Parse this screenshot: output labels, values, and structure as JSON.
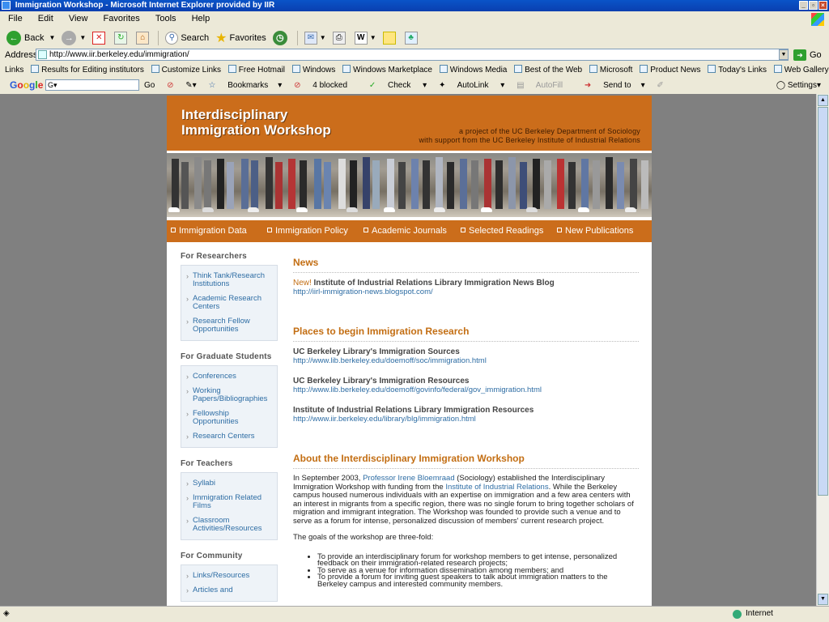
{
  "window": {
    "title": "Immigration Workshop - Microsoft Internet Explorer provided by IIR"
  },
  "menu": [
    "File",
    "Edit",
    "View",
    "Favorites",
    "Tools",
    "Help"
  ],
  "toolbar": {
    "back": "Back",
    "search": "Search",
    "favorites": "Favorites"
  },
  "address": {
    "label": "Address",
    "url": "http://www.iir.berkeley.edu/immigration/",
    "go": "Go"
  },
  "links_bar": {
    "label": "Links",
    "items": [
      "Results for Editing institutors",
      "Customize Links",
      "Free Hotmail",
      "Windows",
      "Windows Marketplace",
      "Windows Media",
      "Best of the Web",
      "Microsoft",
      "Product News",
      "Today's Links",
      "Web Gallery"
    ]
  },
  "google_bar": {
    "logo": "Google",
    "field": "G",
    "go": "Go",
    "bookmarks": "Bookmarks",
    "blocked": "4 blocked",
    "check": "Check",
    "autolink": "AutoLink",
    "autofill": "AutoFill",
    "sendto": "Send to",
    "settings": "Settings"
  },
  "header": {
    "title_line1": "Interdisciplinary",
    "title_line2": "Immigration Workshop",
    "sub_line1": "a project of the UC Berkeley Department of Sociology",
    "sub_line2": "with support from the UC Berkeley Institute of Industrial Relations"
  },
  "nav": [
    "Immigration Data",
    "Immigration Policy",
    "Academic Journals",
    "Selected Readings",
    "New Publications"
  ],
  "sidebar": {
    "sections": [
      {
        "heading": "For Researchers",
        "items": [
          [
            "Think Tank/Research",
            "Institutions"
          ],
          [
            "Academic Research",
            "Centers"
          ],
          [
            "Research Fellow",
            "Opportunities"
          ]
        ]
      },
      {
        "heading": "For Graduate Students",
        "items": [
          [
            "Conferences"
          ],
          [
            "Working",
            "Papers/Bibliographies"
          ],
          [
            "Fellowship",
            "Opportunities"
          ],
          [
            "Research Centers"
          ]
        ]
      },
      {
        "heading": "For Teachers",
        "items": [
          [
            "Syllabi"
          ],
          [
            "Immigration Related",
            "Films"
          ],
          [
            "Classroom",
            "Activities/Resources"
          ]
        ]
      },
      {
        "heading": "For Community",
        "items": [
          [
            "Links/Resources"
          ],
          [
            "Articles and"
          ]
        ]
      }
    ]
  },
  "news": {
    "heading": "News",
    "new_label": "New!",
    "title": "Institute of Industrial Relations Library Immigration News Blog",
    "url": "http://iirl-immigration-news.blogspot.com/"
  },
  "places": {
    "heading": "Places to begin Immigration Research",
    "items": [
      {
        "title": "UC Berkeley Library's Immigration Sources",
        "url": "http://www.lib.berkeley.edu/doemoff/soc/immigration.html"
      },
      {
        "title": "UC Berkeley Library's Immigration Resources",
        "url": "http://www.lib.berkeley.edu/doemoff/govinfo/federal/gov_immigration.html"
      },
      {
        "title": "Institute of Industrial Relations Library Immigration Resources",
        "url": "http://www.iir.berkeley.edu/library/blg/immigration.html"
      }
    ]
  },
  "about": {
    "heading": "About the Interdisciplinary Immigration Workshop",
    "p1_a": "In September 2003, ",
    "p1_link1": "Professor Irene Bloemraad",
    "p1_b": " (Sociology) established the Interdisciplinary Immigration Workshop with funding from the ",
    "p1_link2": "Institute of Industrial Relations",
    "p1_c": ". While the Berkeley campus housed numerous individuals with an expertise on immigration and a few area centers with an interest in migrants from a specific region, there was no single forum to bring together scholars of migration and immigrant integration. The Workshop was founded to provide such a venue and to serve as a forum for intense, personalized discussion of members' current research project.",
    "p2": "The goals of the workshop are three-fold:",
    "goals": [
      "To provide an interdisciplinary forum for workshop members to get intense, personalized feedback on their immigration-related research projects;",
      "To serve as a venue for information dissemination among members; and",
      "To provide a forum for inviting guest speakers to talk about immigration matters to the Berkeley campus and interested community members."
    ]
  },
  "status": {
    "zone": "Internet"
  }
}
